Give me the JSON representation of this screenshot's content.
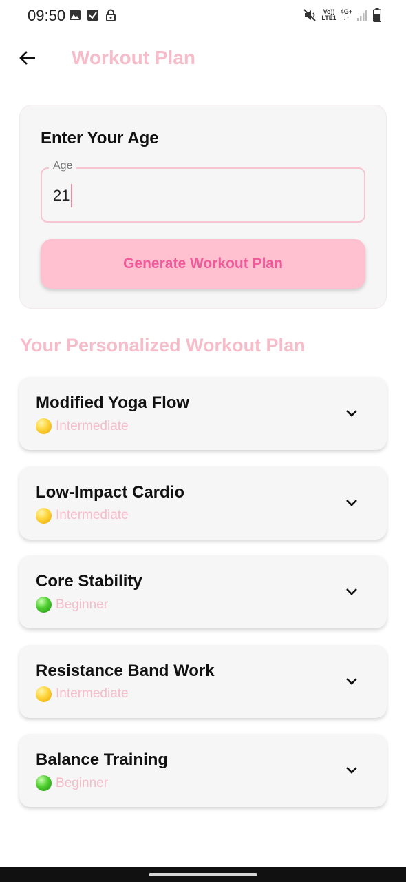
{
  "status_bar": {
    "time": "09:50",
    "left_icons": [
      "image-icon",
      "checkbox-icon",
      "lock-icon"
    ],
    "volte_label": "Vo))\nLTE1",
    "network_label": "4G+"
  },
  "app_bar": {
    "title": "Workout Plan",
    "back_icon": "arrow-left-icon"
  },
  "age_card": {
    "heading": "Enter Your Age",
    "field_label": "Age",
    "field_value": "21",
    "button_label": "Generate Workout Plan"
  },
  "plan": {
    "heading": "Your Personalized Workout Plan",
    "workouts": [
      {
        "name": "Modified Yoga Flow",
        "level": "Intermediate",
        "level_color": "yellow"
      },
      {
        "name": "Low-Impact Cardio",
        "level": "Intermediate",
        "level_color": "yellow"
      },
      {
        "name": "Core Stability",
        "level": "Beginner",
        "level_color": "green"
      },
      {
        "name": "Resistance Band Work",
        "level": "Intermediate",
        "level_color": "yellow"
      },
      {
        "name": "Balance Training",
        "level": "Beginner",
        "level_color": "green"
      }
    ]
  },
  "colors": {
    "accent_pink": "#f6bcc9",
    "button_bg": "#ffc1cf",
    "button_text": "#f05a9a",
    "card_bg": "#f6f6f6"
  }
}
